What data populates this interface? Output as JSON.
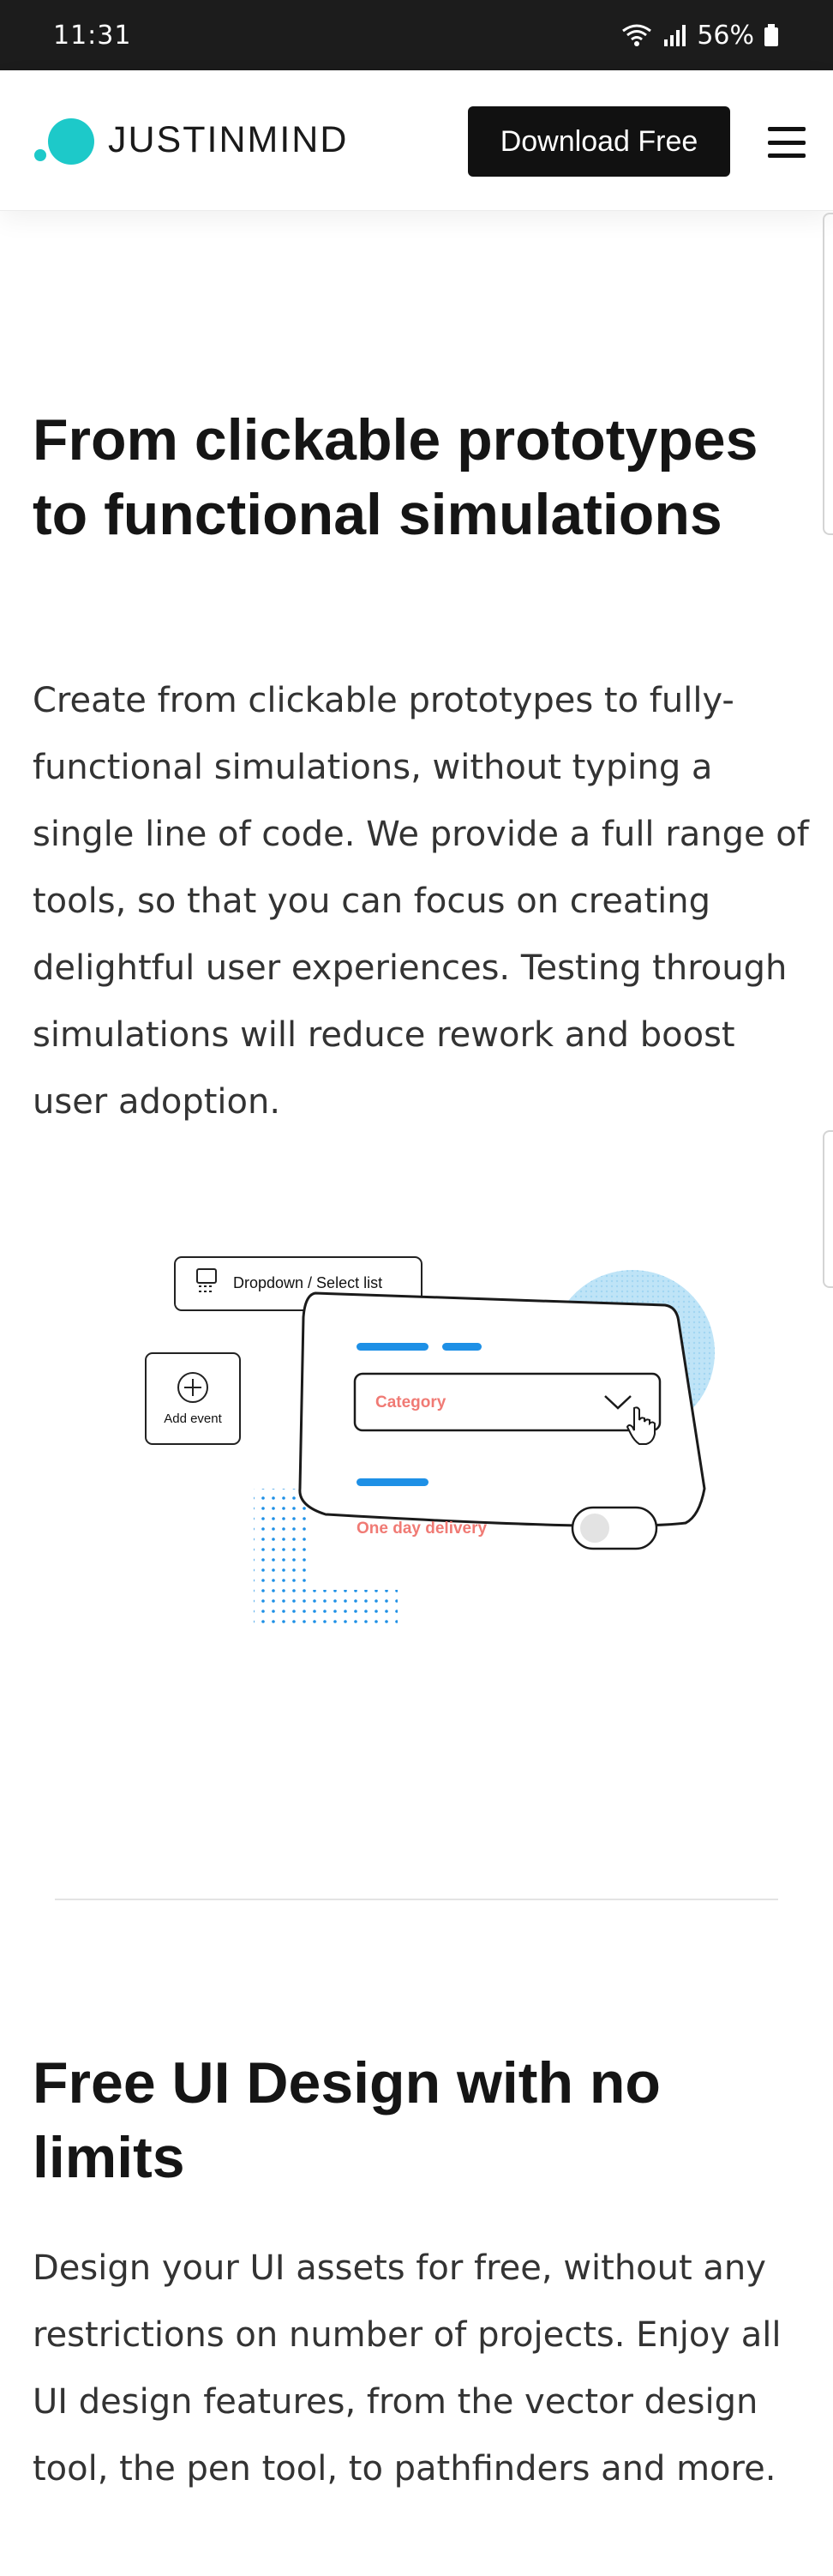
{
  "status_bar": {
    "time": "11:31",
    "battery": "56%"
  },
  "header": {
    "logo_text": "JUSTINMIND",
    "download_label": "Download Free",
    "brand_color": "#1dc9c9"
  },
  "section1": {
    "title": "From clickable prototypes to functional simulations",
    "body": "Create from clickable prototypes to fully-functional simulations, without typing a single line of code. We provide a full range of tools, so that you can focus on creating delightful user experiences. Testing through simulations will reduce rework and boost user adoption."
  },
  "illustration": {
    "dropdown_chip_label": "Dropdown / Select list",
    "add_event_label": "Add event",
    "category_label": "Category",
    "delivery_label": "One day delivery",
    "accent_blue": "#1e90e6",
    "accent_red": "#f07a74",
    "circle_color": "#bfe4f7"
  },
  "section2": {
    "title": "Free UI Design with no limits",
    "body": "Design your UI assets for free, without any restrictions on number of projects. Enjoy all UI design features, from the vector design tool, the pen tool, to pathfinders and more."
  }
}
